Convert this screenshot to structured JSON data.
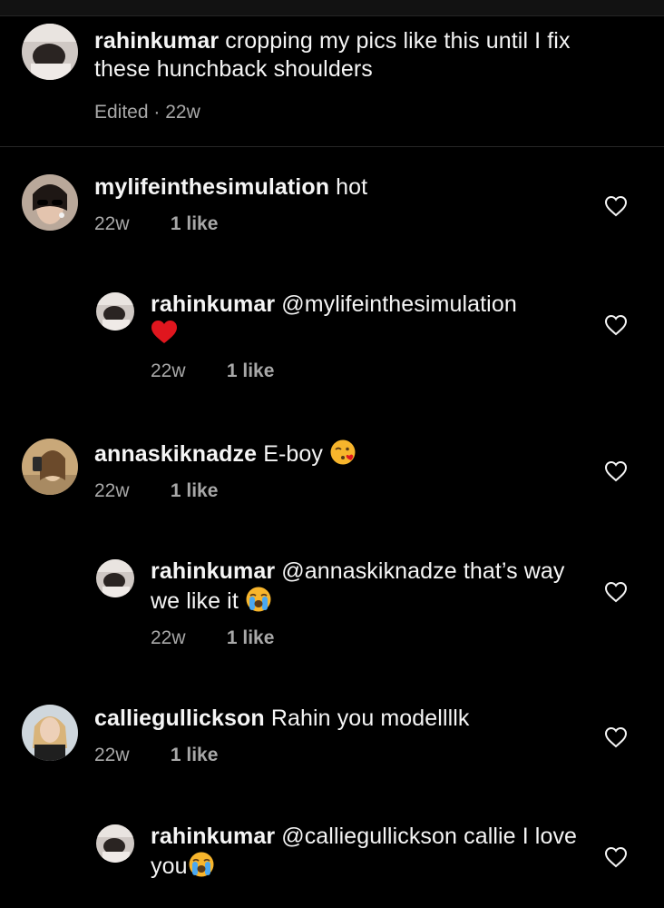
{
  "caption": {
    "username": "rahinkumar",
    "text": "cropping my pics like this until I fix these hunchback shoulders",
    "meta": "Edited · 22w"
  },
  "comments": [
    {
      "username": "mylifeinthesimulation",
      "text": "hot",
      "time": "22w",
      "likes": "1 like",
      "avatar_icon": "avatar-woman-sunglasses"
    },
    {
      "username": "rahinkumar",
      "text": "@mylifeinthesimulation",
      "emoji": "red-heart-emoji",
      "time": "22w",
      "likes": "1 like",
      "avatar_icon": "avatar-rahinkumar"
    },
    {
      "username": "annaskiknadze",
      "text": "E-boy",
      "emoji": "face-blowing-kiss-emoji",
      "time": "22w",
      "likes": "1 like",
      "avatar_icon": "avatar-woman-selfie"
    },
    {
      "username": "rahinkumar",
      "text": "@annaskiknadze that’s way we like it",
      "emoji": "loudly-crying-face-emoji",
      "time": "22w",
      "likes": "1 like",
      "avatar_icon": "avatar-rahinkumar"
    },
    {
      "username": "calliegullickson",
      "text": "Rahin you modellllk",
      "time": "22w",
      "likes": "1 like",
      "avatar_icon": "avatar-woman-blonde"
    },
    {
      "username": "rahinkumar",
      "text": "@calliegullickson callie I love you",
      "emoji": "loudly-crying-face-emoji",
      "time": "22w",
      "likes": "1 like",
      "avatar_icon": "avatar-rahinkumar"
    }
  ],
  "colors": {
    "background": "#000000",
    "primary_text": "#f5f5f5",
    "secondary_text": "#a8a8a8",
    "divider": "#262626"
  }
}
